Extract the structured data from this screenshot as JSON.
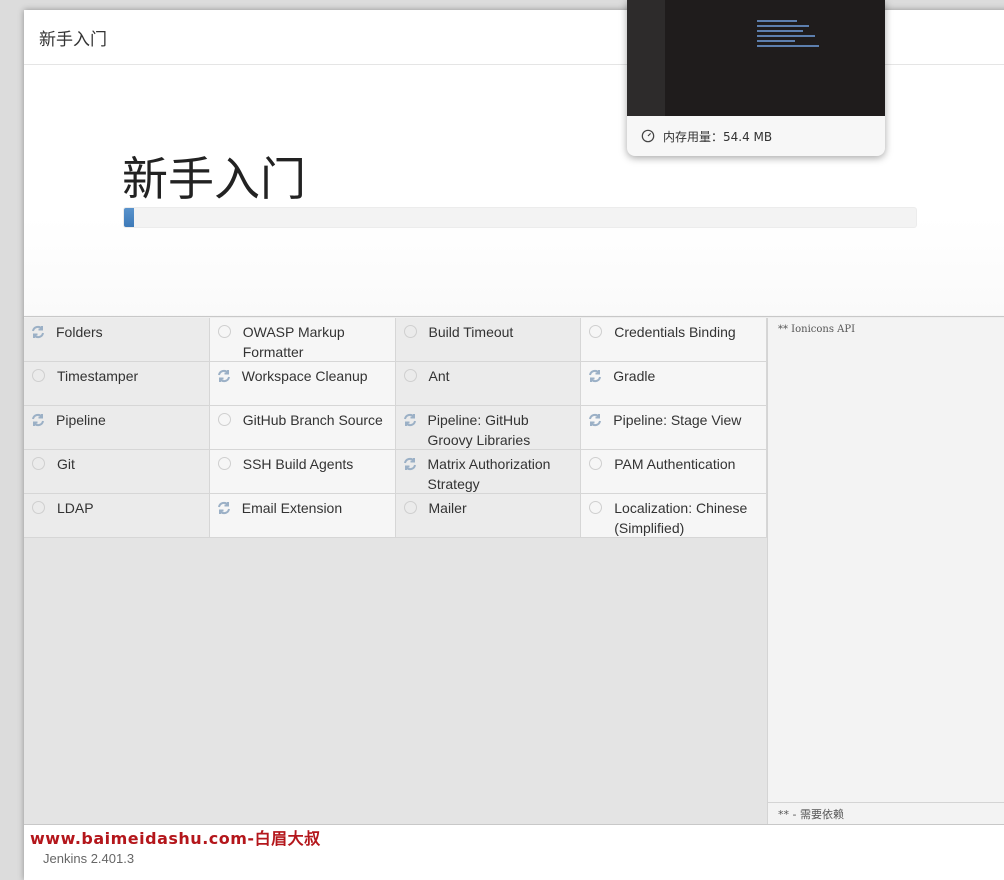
{
  "dialog": {
    "header_title": "新手入门",
    "hero_title": "新手入门",
    "progress": 0.012
  },
  "plugins": [
    {
      "label": "Folders",
      "status": "loading"
    },
    {
      "label": "OWASP Markup Formatter",
      "status": "pending"
    },
    {
      "label": "Build Timeout",
      "status": "pending"
    },
    {
      "label": "Credentials Binding",
      "status": "pending"
    },
    {
      "label": "Timestamper",
      "status": "pending"
    },
    {
      "label": "Workspace Cleanup",
      "status": "loading"
    },
    {
      "label": "Ant",
      "status": "pending"
    },
    {
      "label": "Gradle",
      "status": "loading"
    },
    {
      "label": "Pipeline",
      "status": "loading"
    },
    {
      "label": "GitHub Branch Source",
      "status": "pending"
    },
    {
      "label": "Pipeline: GitHub Groovy Libraries",
      "status": "loading"
    },
    {
      "label": "Pipeline: Stage View",
      "status": "loading"
    },
    {
      "label": "Git",
      "status": "pending"
    },
    {
      "label": "SSH Build Agents",
      "status": "pending"
    },
    {
      "label": "Matrix Authorization Strategy",
      "status": "loading"
    },
    {
      "label": "PAM Authentication",
      "status": "pending"
    },
    {
      "label": "LDAP",
      "status": "pending"
    },
    {
      "label": "Email Extension",
      "status": "loading"
    },
    {
      "label": "Mailer",
      "status": "pending"
    },
    {
      "label": "Localization: Chinese (Simplified)",
      "status": "pending"
    }
  ],
  "log": {
    "text": "** Ionicons API",
    "footer": "** - 需要依赖"
  },
  "footer": {
    "watermark": "www.baimeidashu.com-白眉大叔",
    "version": "Jenkins 2.401.3"
  },
  "popup": {
    "memory": "内存用量：54.4 MB"
  },
  "colors": {
    "progress": "#3d7ab8",
    "watermark": "#b4161b",
    "loading_icon": "#9bb0c6"
  }
}
